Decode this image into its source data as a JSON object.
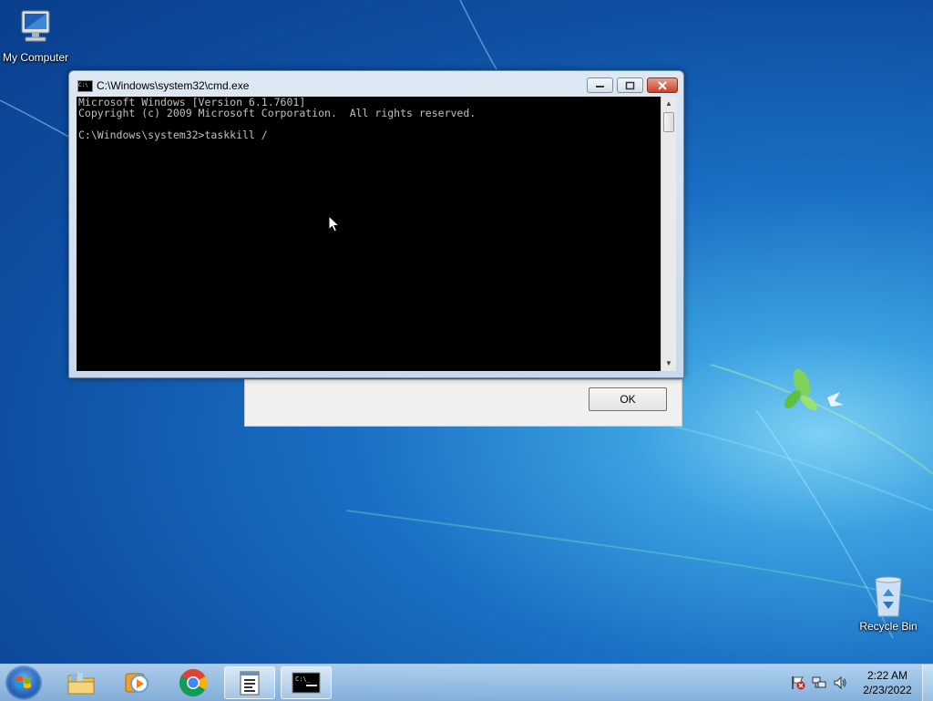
{
  "desktop": {
    "icons": [
      {
        "label": "My Computer"
      },
      {
        "label": "Recycle Bin"
      }
    ]
  },
  "cmd": {
    "title": "C:\\Windows\\system32\\cmd.exe",
    "lines": [
      "Microsoft Windows [Version 6.1.7601]",
      "Copyright (c) 2009 Microsoft Corporation.  All rights reserved.",
      "",
      "C:\\Windows\\system32>taskkill /"
    ]
  },
  "dialog": {
    "ok_label": "OK"
  },
  "taskbar": {
    "items": [
      {
        "name": "windows-explorer-icon"
      },
      {
        "name": "media-player-icon"
      },
      {
        "name": "chrome-icon"
      },
      {
        "name": "notepad-icon"
      },
      {
        "name": "cmd-icon",
        "active": true
      }
    ],
    "clock": {
      "time": "2:22 AM",
      "date": "2/23/2022"
    }
  },
  "colors": {
    "console_bg": "#000000",
    "console_fg": "#c0c0c0",
    "close_button": "#c8412a"
  }
}
